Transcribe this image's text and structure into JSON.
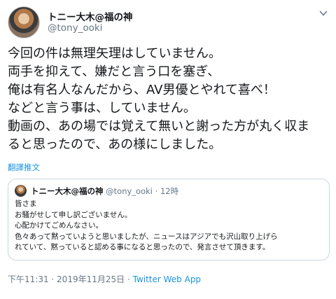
{
  "author": {
    "name": "トニー大木@福の神",
    "handle": "@tony_ooki"
  },
  "tweet": {
    "lines": [
      "今回の件は無理矢理はしていません。",
      "両手を抑えて、嫌だと言う口を塞ぎ、",
      "俺は有名人なんだから、AV男優とやれて喜べ！",
      "などと言う事は、していません。",
      "動画の、あの場では覚えて無いと謝った方が丸く収ま",
      "ると思ったので、あの様にしました。"
    ],
    "translate_label": "翻譯推文"
  },
  "quoted": {
    "name": "トニー大木@福の神",
    "handle": "@tony_ooki",
    "separator": "·",
    "age": "12時",
    "lines": [
      "皆さま",
      "お騒がせして申し訳ございません。",
      "心配かけてごめんなさい。",
      "色々あって黙っていようと思いましたが、ニュースはアジアでも沢山取り上げら",
      "れていて、黙っていると認める事になると思ったので、発言させて頂きます。"
    ]
  },
  "footer": {
    "time": "下午11:31",
    "separator1": " · ",
    "date": "2019年11月25日",
    "separator2": " · ",
    "source": "Twitter Web App"
  },
  "icons": {
    "menu": "chevron-down-icon"
  },
  "colors": {
    "link": "#1b95e0",
    "muted": "#657786",
    "border": "#ccd6dd"
  }
}
